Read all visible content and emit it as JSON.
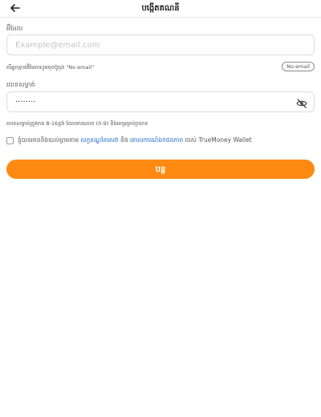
{
  "header": {
    "title": "បង្កើតគណនី"
  },
  "email": {
    "label": "អ៊ីមែល",
    "placeholder": "Example@email.com",
    "hint": "បើអ្នកគ្មានអ៊ីមែលសូមចុចប៊ូតុង \"No email\"",
    "no_email_label": "No email"
  },
  "password": {
    "label": "លេខសម្ងាត់",
    "value": "········",
    "hint": "លេខសម្ងាត់ត្រូវមាន 8-16ខ្ទង់ ដែលមានលេខ (0-9) និងអក្សរគ្រប់ប្រភេទ"
  },
  "terms": {
    "prefix": "ខ្ញុំបានអាននិងយល់ព្រមតាម ",
    "link1": "លក្ខខណ្ឌនៃសេវា",
    "middle": " និង ",
    "link2": "គោលការណ៍ឯកជនភាព",
    "suffix": " របស់ TrueMoney Wallet"
  },
  "continue_label": "បន្ត",
  "colors": {
    "accent": "#ff8a12",
    "link": "#1a66c9"
  }
}
